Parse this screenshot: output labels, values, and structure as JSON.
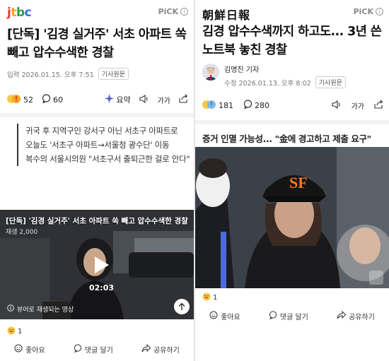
{
  "left": {
    "brand": {
      "j": "j",
      "t": "t",
      "b": "b",
      "c": "c"
    },
    "pick": "PiCK",
    "pick_info": "i",
    "headline": "[단독] '김경 실거주' 서초 아파트 쏙 빼고 압수수색한 경찰",
    "meta_date": "입력 2026.01.15. 오후 7:51",
    "orig_button": "기사원문",
    "reactions": {
      "emotion_count": "52",
      "comment_count": "60",
      "summary": "요약",
      "font": "가가"
    },
    "summary_lines": [
      "귀국 후 지역구인 강서구 아닌 서초구 아파트로",
      "오늘도 '서초구 아파트→서울청 광수단' 이동",
      "복수의 서울시의원 \"서초구서 출퇴근한 걸로 안다\""
    ],
    "video": {
      "overlay_title": "[단독] '김경 실거주' 서초 아파트 쏙 빼고 압수수색한 경찰",
      "views": "재생 2,000",
      "duration": "02:03",
      "note": "뷰어로 재생되는 영상"
    },
    "bottom_count": "1",
    "actions": {
      "like": "좋아요",
      "comment": "댓글 달기",
      "share": "공유하기"
    }
  },
  "right": {
    "brand": "朝鮮日報",
    "pick": "PiCK",
    "pick_info": "i",
    "headline": "김경 압수수색까지 하고도... 3년 쓴 노트북 놓친 경찰",
    "author": "김명진 기자",
    "meta_date": "수정 2026.01.13. 오후 8:02",
    "orig_button": "기사원문",
    "reactions": {
      "emotion_count": "181",
      "comment_count": "280",
      "font": "가가"
    },
    "subhead": "증거 인멸 가능성... \"金에 경고하고 제출 요구\"",
    "bottom_count": "1",
    "actions": {
      "like": "좋아요",
      "comment": "댓글 달기",
      "share": "공유하기"
    }
  },
  "colors": {
    "jtbc_j": "#e63a2f",
    "jtbc_t": "#f4a21b",
    "jtbc_b": "#2a9d47",
    "jtbc_c": "#2a6fd8",
    "summary_accent": "#5b5bd6",
    "text": "#111111"
  }
}
